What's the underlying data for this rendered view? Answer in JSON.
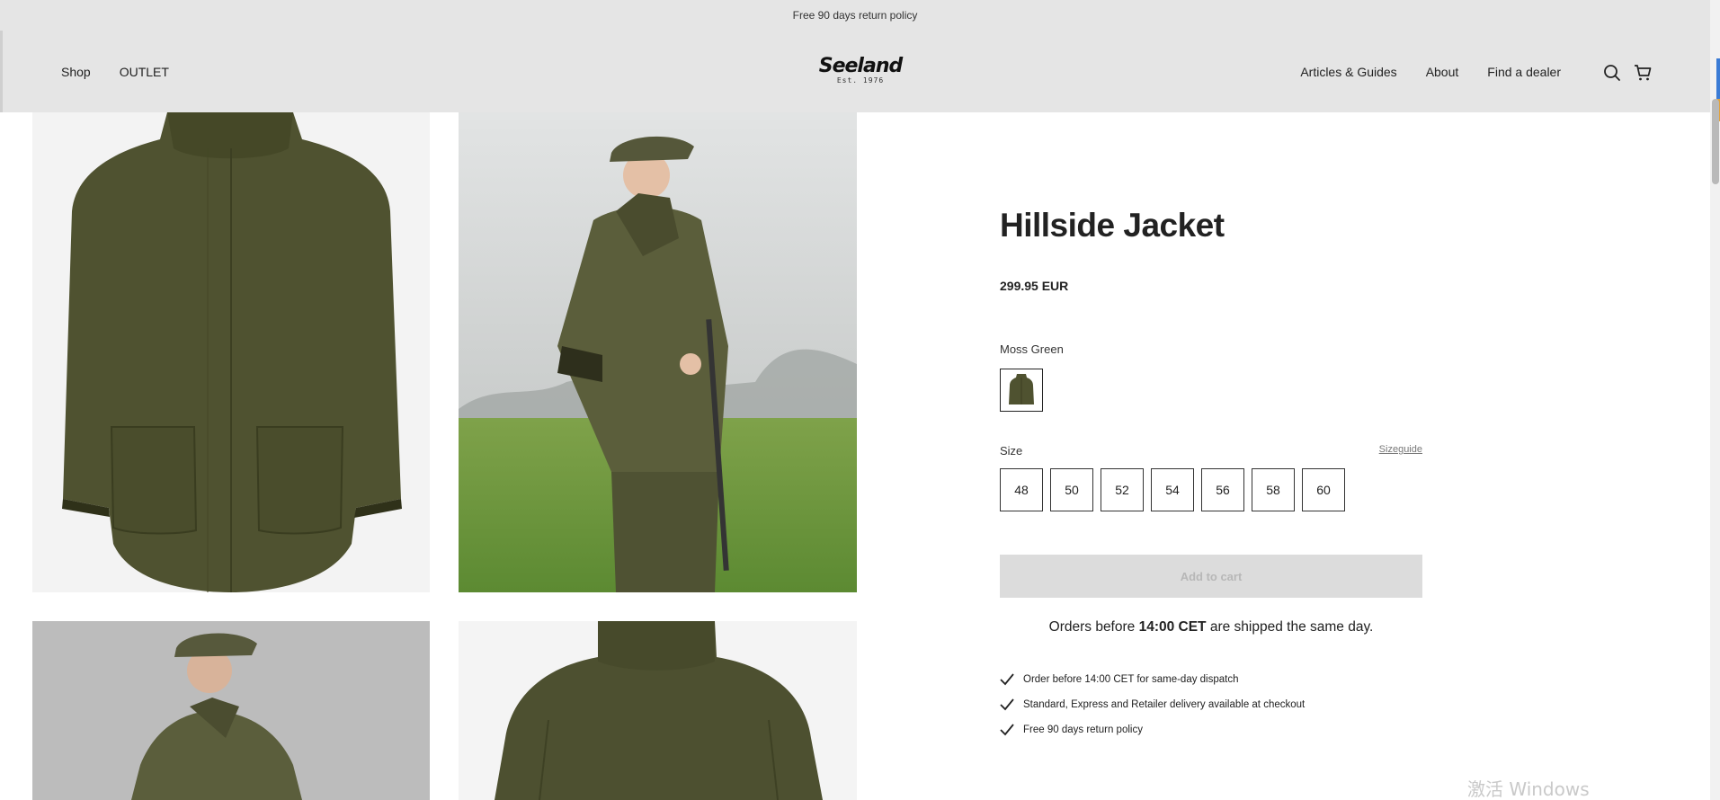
{
  "announcement": "Free 90 days return policy",
  "header": {
    "nav_left": [
      "Shop",
      "OUTLET"
    ],
    "logo": {
      "word": "Seeland",
      "est": "Est. 1976"
    },
    "nav_right": [
      "Articles & Guides",
      "About",
      "Find a dealer"
    ],
    "icons": [
      "search-icon",
      "cart-icon"
    ]
  },
  "gallery": [
    {
      "name": "jacket-front-image"
    },
    {
      "name": "model-field-image"
    },
    {
      "name": "model-grey-image"
    },
    {
      "name": "jacket-back-image"
    }
  ],
  "product": {
    "title": "Hillside Jacket",
    "price": "299.95 EUR",
    "color_label": "Moss Green",
    "size_label": "Size",
    "sizeguide_label": "Sizeguide",
    "sizes": [
      "48",
      "50",
      "52",
      "54",
      "56",
      "58",
      "60"
    ],
    "add_to_cart": "Add to cart",
    "ship_note": {
      "before": "Orders before ",
      "bold": "14:00 CET",
      "after": " are shipped the same day."
    },
    "usps": [
      "Order before 14:00 CET for same-day dispatch",
      "Standard, Express and Retailer delivery available at checkout",
      "Free 90 days return policy"
    ]
  },
  "watermark": "激活 Windows",
  "colors": {
    "header_bg": "#e5e5e5",
    "jacket_green": "#4f5230",
    "cart_disabled": "#dcdcdc"
  }
}
